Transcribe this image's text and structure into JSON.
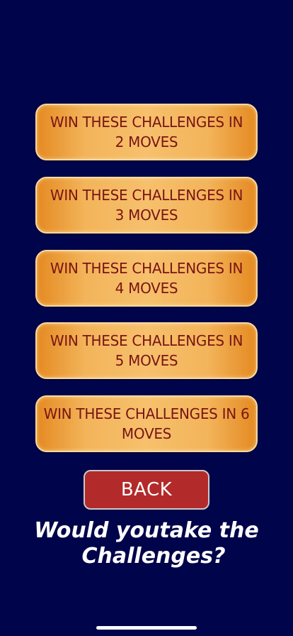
{
  "buttons": [
    {
      "line1": "WIN THESE CHALLENGES IN",
      "line2": "2 MOVES"
    },
    {
      "line1": "WIN THESE CHALLENGES IN",
      "line2": "3 MOVES"
    },
    {
      "line1": "WIN THESE CHALLENGES IN",
      "line2": "4 MOVES"
    },
    {
      "line1": "WIN THESE CHALLENGES IN",
      "line2": "5 MOVES"
    },
    {
      "line1": "WIN THESE CHALLENGES IN 6",
      "line2": "MOVES"
    }
  ],
  "back_label": "BACK",
  "question": {
    "line1": "Would youtake the",
    "line2": "Challenges?"
  },
  "colors": {
    "background": "#00044a",
    "button_text": "#7a1414",
    "button_gold": "#f3b45a",
    "back_red": "#b32a2a"
  }
}
